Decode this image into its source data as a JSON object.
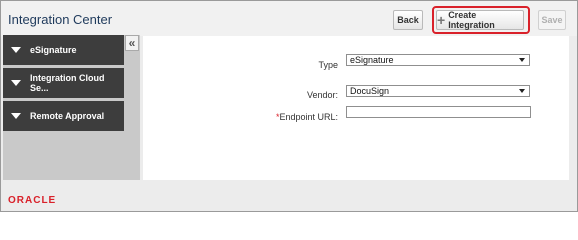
{
  "header": {
    "title": "Integration Center",
    "back_label": "Back",
    "create_label": "Create Integration",
    "save_label": "Save",
    "create_icon": "plus-icon"
  },
  "sidebar": {
    "collapse_glyph": "«",
    "items": [
      {
        "label": "eSignature"
      },
      {
        "label": "Integration Cloud Se..."
      },
      {
        "label": "Remote Approval"
      }
    ]
  },
  "form": {
    "type_label": "Type",
    "type_value": "eSignature",
    "vendor_label": "Vendor:",
    "vendor_value": "DocuSign",
    "endpoint_required_mark": "*",
    "endpoint_label": "Endpoint URL:",
    "endpoint_value": ""
  },
  "footer": {
    "logo_text": "ORACLE"
  },
  "colors": {
    "highlight": "#d9212a",
    "sidebar_item_bg": "#3d3d3d",
    "title": "#1f3a5c",
    "logo": "#d9212a"
  }
}
